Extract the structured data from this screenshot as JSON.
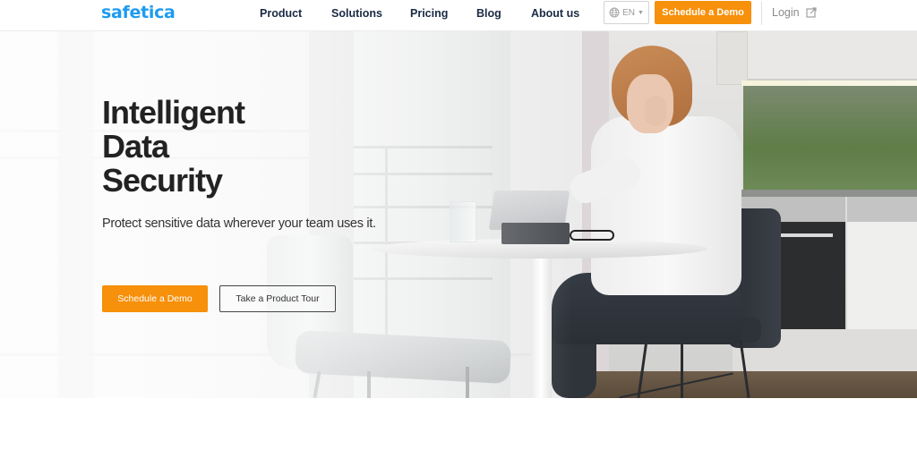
{
  "brand": {
    "logo_text": "safetica",
    "logo_color": "#1e9bf0",
    "accent_color": "#f7900a"
  },
  "nav": {
    "links": [
      {
        "label": "Product"
      },
      {
        "label": "Solutions"
      },
      {
        "label": "Pricing"
      },
      {
        "label": "Blog"
      },
      {
        "label": "About us"
      }
    ],
    "language": {
      "icon": "globe-icon",
      "selected": "EN",
      "caret_icon": "caret-down-icon"
    },
    "cta_label": "Schedule a Demo",
    "login_label": "Login",
    "login_icon": "external-link-icon"
  },
  "hero": {
    "title_lines": [
      "Intelligent",
      "Data",
      "Security"
    ],
    "subtitle": "Protect sensitive data wherever your team uses it.",
    "primary_button": "Schedule a Demo",
    "secondary_button": "Take a Product Tour",
    "image_description": "Woman on phone using tablet at white round table in kitchen"
  }
}
